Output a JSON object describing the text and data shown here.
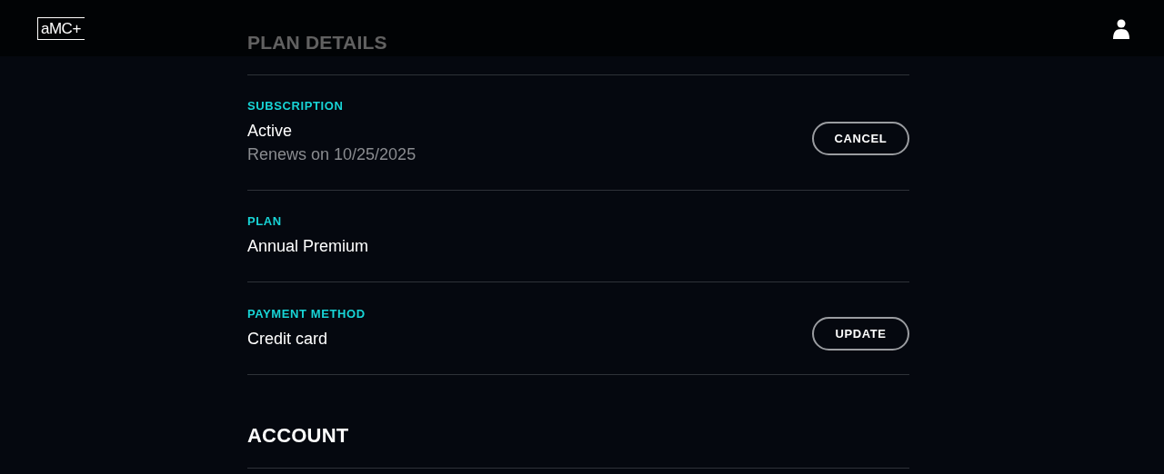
{
  "header": {
    "logo": "aMC+"
  },
  "sections": [
    {
      "title": "PLAN DETAILS",
      "rows": [
        {
          "label": "SUBSCRIPTION",
          "value": "Active",
          "note": "Renews on 10/25/2025",
          "action": "CANCEL"
        },
        {
          "label": "PLAN",
          "value": "Annual Premium"
        },
        {
          "label": "PAYMENT METHOD",
          "value": "Credit card",
          "action": "UPDATE"
        }
      ]
    },
    {
      "title": "ACCOUNT"
    }
  ]
}
